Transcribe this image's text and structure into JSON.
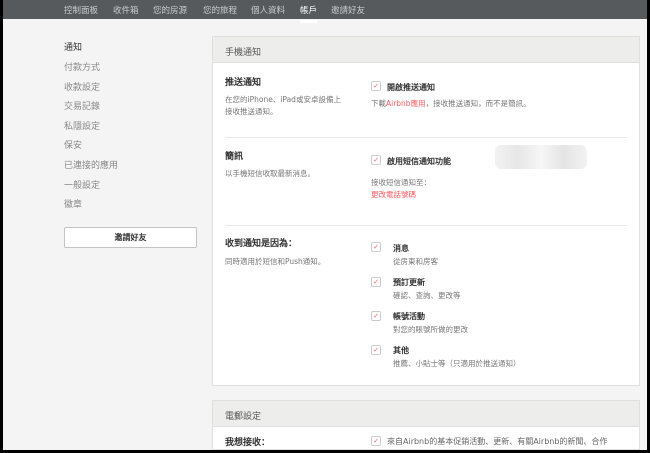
{
  "topnav": [
    "控制面板",
    "收件箱",
    "您的房源",
    "您的旅程",
    "個人資料",
    "帳戶",
    "邀請好友"
  ],
  "sidebar": {
    "items": [
      "通知",
      "付款方式",
      "收款設定",
      "交易記錄",
      "私隱設定",
      "保安",
      "已連接的應用",
      "一般設定",
      "徽章"
    ],
    "invite_button": "邀請好友"
  },
  "mobile": {
    "title": "手機通知",
    "push": {
      "title": "推送通知",
      "desc": "在您的iPhone、iPad或安卓設備上接收推送通知。",
      "checkbox": "開啟推送通知",
      "note_pre": "下載",
      "note_link": "Airbnb應用",
      "note_post": "，接收推送通知，而不是簡訊。"
    },
    "sms": {
      "title": "簡訊",
      "desc": "以手機短信收取最新消息。",
      "checkbox": "啟用短信通知功能",
      "receive_label": "接收短信通知至：",
      "change_link": "更改電話號碼"
    },
    "reasons": {
      "title": "收到通知是因為：",
      "desc": "同時適用於短信和Push通知。",
      "items": [
        {
          "label": "消息",
          "desc": "從房東和房客"
        },
        {
          "label": "預訂更新",
          "desc": "確認、查詢、更改等"
        },
        {
          "label": "帳號活動",
          "desc": "對您的賬號所做的更改"
        },
        {
          "label": "其他",
          "desc": "推薦、小貼士等（只適用於推送通知）"
        }
      ]
    }
  },
  "email": {
    "title": "電郵設定",
    "receive_title": "我想接收：",
    "first_item": "來自Airbnb的基本促銷活動、更新、有關Airbnb的新聞、合作"
  },
  "check": "✓"
}
